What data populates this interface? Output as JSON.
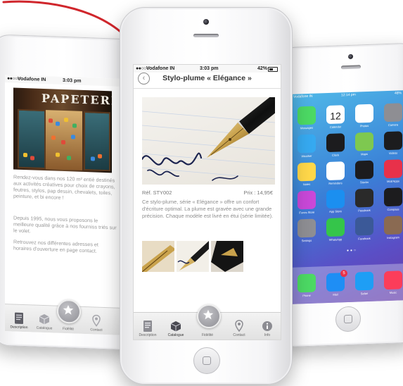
{
  "center_phone": {
    "status": {
      "carrier": "Vodafone IN",
      "time": "3:03 pm",
      "battery": "42%"
    },
    "nav": {
      "back_icon": "chevron-left-icon",
      "title": "Stylo-plume « Elégance »"
    },
    "product": {
      "ref": "Réf. STY002",
      "price": "Prix : 14,95€",
      "description": "Ce stylo-plume, série « Elégance » offre un confort d'écriture optimal. La plume est gravée avec une grande précision. Chaque modèle est livré en étui (série limitée)."
    },
    "tabs": [
      {
        "label": "Description",
        "icon": "document-icon"
      },
      {
        "label": "Catalogue",
        "icon": "box-icon"
      },
      {
        "label": "Fidélité",
        "icon": "star-icon"
      },
      {
        "label": "Contact",
        "icon": "map-pin-icon"
      },
      {
        "label": "Info",
        "icon": "info-icon"
      }
    ]
  },
  "left_phone": {
    "status": {
      "carrier": "Vodafone IN",
      "time": "3:03 pm"
    },
    "store_sign": "PAPETERIE",
    "paragraphs": [
      "Rendez-vous dans nos 120 m² entiè destinés aux activités créatives pour choix de crayons, feutres, stylos, pap dessin, chevalets, toiles, peinture, et bi encore !",
      "Depuis 1995, nous vous proposons le meilleure qualité grâce à nos fourniss triés sur le volet.",
      "Retrouvez nos différentes adresses et horaires d'ouverture en page contact."
    ],
    "tabs": [
      {
        "label": "Description",
        "icon": "document-icon"
      },
      {
        "label": "Catalogue",
        "icon": "box-icon"
      },
      {
        "label": "Fidélité",
        "icon": "star-icon"
      },
      {
        "label": "Contact",
        "icon": "map-pin-icon"
      }
    ]
  },
  "right_phone": {
    "status": {
      "carrier": "Vodafone IN",
      "time": "12:14 pm",
      "battery": "48%"
    },
    "date_number": "12",
    "apps": [
      {
        "label": "Messages",
        "color": "#4cd964"
      },
      {
        "label": "Calendar",
        "color": "#ffffff"
      },
      {
        "label": "Photos",
        "color": "#ffffff"
      },
      {
        "label": "Camera",
        "color": "#8e8e93"
      },
      {
        "label": "Weather",
        "color": "#36a9f0"
      },
      {
        "label": "Clock",
        "color": "#1c1c1e"
      },
      {
        "label": "Maps",
        "color": "#7ec850"
      },
      {
        "label": "Videos",
        "color": "#1c1c1e"
      },
      {
        "label": "Notes",
        "color": "#ffd84a"
      },
      {
        "label": "Reminders",
        "color": "#ffffff"
      },
      {
        "label": "Stocks",
        "color": "#1c1c1e"
      },
      {
        "label": "Mob'Apps",
        "color": "#e8314a"
      },
      {
        "label": "iTunes Store",
        "color": "#c848d8"
      },
      {
        "label": "App Store",
        "color": "#1b8ff0"
      },
      {
        "label": "Passbook",
        "color": "#2a2a2a"
      },
      {
        "label": "Compass",
        "color": "#1c1c1e"
      },
      {
        "label": "Settings",
        "color": "#8e8e93"
      },
      {
        "label": "WhatsApp",
        "color": "#35c54a"
      },
      {
        "label": "Facebook",
        "color": "#3b5998"
      },
      {
        "label": "Instagram",
        "color": "#8a6a52"
      }
    ],
    "dock": [
      {
        "label": "Phone",
        "color": "#4cd964"
      },
      {
        "label": "Mail",
        "color": "#1e8ef5",
        "badge": "5"
      },
      {
        "label": "Safari",
        "color": "#1e9ef5"
      },
      {
        "label": "Music",
        "color": "#fc3d5a"
      }
    ]
  },
  "colors": {
    "arrow": "#d0262c",
    "star_grey": "#9c9ca2"
  }
}
